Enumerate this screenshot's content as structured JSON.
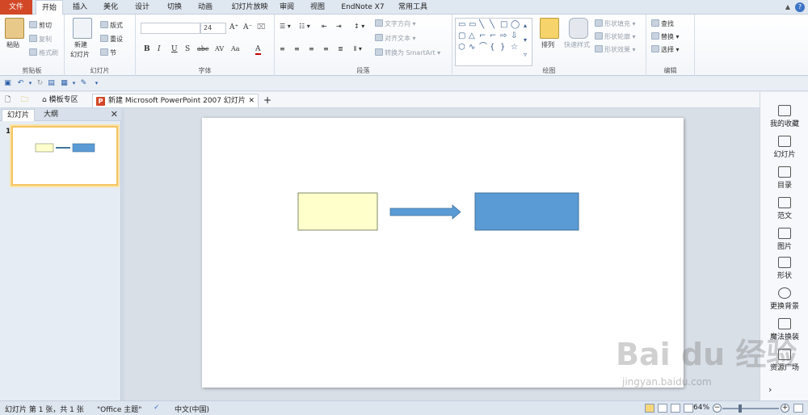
{
  "ribbon_tabs": [
    "文件",
    "开始",
    "插入",
    "美化",
    "设计",
    "切换",
    "动画",
    "幻灯片放映",
    "审阅",
    "视图",
    "EndNote X7",
    "常用工具"
  ],
  "clipboard": {
    "paste": "粘贴",
    "cut": "剪切",
    "copy": "复制",
    "format_painter": "格式刷",
    "label": "剪贴板"
  },
  "slides_group": {
    "new_slide": "新建",
    "new_slide2": "幻灯片",
    "layout": "版式",
    "reset": "重设",
    "section": "节",
    "label": "幻灯片"
  },
  "font_group": {
    "font_size": "24",
    "label": "字体",
    "bold": "B",
    "italic": "I",
    "underline": "U",
    "shadow": "S",
    "strike": "abc",
    "spacing": "AV",
    "case": "Aa",
    "font_color": "A"
  },
  "paragraph_group": {
    "text_direction": "文字方向",
    "align_text": "对齐文本",
    "smartart": "转换为 SmartArt",
    "label": "段落"
  },
  "drawing_group": {
    "arrange": "排列",
    "quick_styles": "快速样式",
    "shape_fill": "形状填充",
    "shape_outline": "形状轮廓",
    "shape_effects": "形状效果",
    "label": "绘图"
  },
  "editing_group": {
    "find": "查找",
    "replace": "替换",
    "select": "选择",
    "label": "编辑"
  },
  "doc_tabs": {
    "template_zone": "模板专区",
    "doc_name": "新建 Microsoft PowerPoint 2007 幻灯片",
    "ppt_badge": "P"
  },
  "left_pane": {
    "tab_slides": "幻灯片",
    "tab_outline": "大纲",
    "slide_number": "1"
  },
  "right_pane": [
    "我的收藏",
    "幻灯片",
    "目录",
    "范文",
    "图片",
    "形状",
    "更换背景",
    "魔法换装",
    "资源广场"
  ],
  "status": {
    "slide_info": "幻灯片 第 1 张，共 1 张",
    "theme": "\"Office 主题\"",
    "language": "中文(中国)",
    "zoom": "64%"
  },
  "watermark": {
    "main": "Bai du 经验",
    "sub": "jingyan.baidu.com"
  },
  "colors": {
    "yellow_box": "#ffffcc",
    "blue_box": "#5b9bd5",
    "accent": "#d24726"
  }
}
